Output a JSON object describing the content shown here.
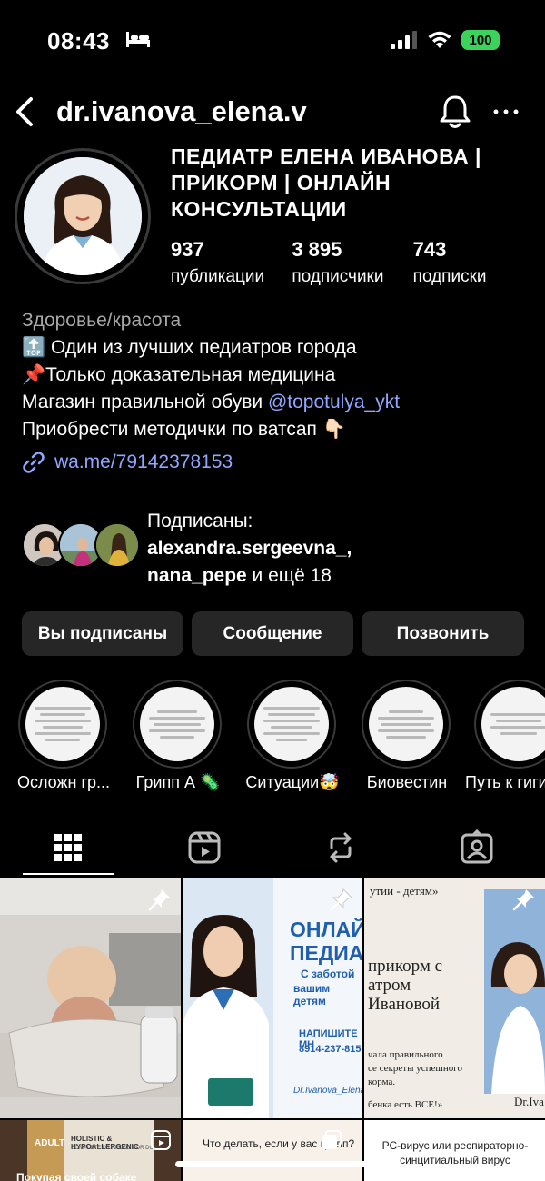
{
  "status_bar": {
    "time": "08:43",
    "battery": "100"
  },
  "header": {
    "username": "dr.ivanova_elena.v"
  },
  "profile": {
    "name": "ПЕДИАТР ЕЛЕНА ИВАНОВА | ПРИКОРМ | ОНЛАЙН КОНСУЛЬТАЦИИ",
    "stats": [
      {
        "value": "937",
        "label": "публикации"
      },
      {
        "value": "3 895",
        "label": "подписчики"
      },
      {
        "value": "743",
        "label": "подписки"
      }
    ],
    "category": "Здоровье/красота",
    "bio_lines": [
      "🔝 Один из лучших педиатров города",
      "📌Только доказательная медицина",
      "Магазин правильной обуви ",
      "Приобрести методички по ватсап 👇🏻"
    ],
    "bio_mention": "@topotulya_ykt",
    "link": "wa.me/79142378153"
  },
  "followed_by": {
    "prefix": "Подписаны:",
    "names": "alexandra.sergeevna_,",
    "names2": "nana_pepe",
    "suffix": " и ещё 18"
  },
  "buttons": {
    "following": "Вы подписаны",
    "message": "Сообщение",
    "call": "Позвонить"
  },
  "highlights": [
    {
      "label": "Осложн гр..."
    },
    {
      "label": "Грипп А 🦠"
    },
    {
      "label": "Ситуации🤯"
    },
    {
      "label": "Биовестин"
    },
    {
      "label": "Путь к гиги..."
    }
  ],
  "tabs": [
    "grid-icon",
    "reels-icon",
    "repost-icon",
    "tagged-icon"
  ],
  "posts": [
    {
      "caption": ""
    },
    {
      "title": "ОНЛАЙН ПЕДИАТ",
      "line1": "С заботой",
      "line2": "вашим детям",
      "write": "НАПИШИТЕ МН",
      "phone": "8914-237-815",
      "sign": "Dr.Ivanova_Elena."
    },
    {
      "top": "утии - детям»",
      "l1": "прикорм с",
      "l2": "атром",
      "l3": "Ивановой",
      "s1": "чала правильного",
      "s2": "се секреты успешного",
      "s3": "корма.",
      "s4": "бенка есть ВСЕ!»",
      "sign": "Dr.Iva"
    },
    {
      "caption": "ADULT",
      "brand": "HOLISTIC & HYPOALLERGENIC",
      "sub": "COMPLETE DRY FOOD FOR DOGS",
      "bottom": "Покупая своей собаке"
    },
    {
      "caption": "Что делать, если у вас грипп?"
    },
    {
      "caption": "РС-вирус или респираторно-синцитиальный вирус"
    }
  ]
}
